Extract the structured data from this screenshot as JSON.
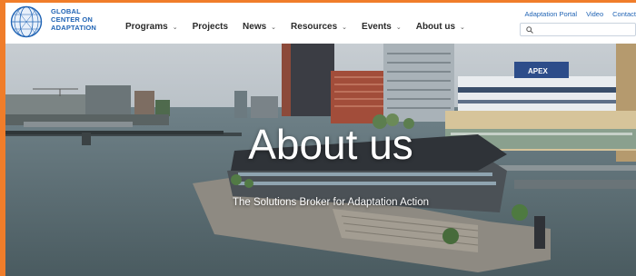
{
  "logo": {
    "lines": [
      "GLOBAL",
      "CENTER ON",
      "ADAPTATION"
    ],
    "icon": "globe-icon"
  },
  "nav": [
    {
      "label": "Programs",
      "has_dropdown": true
    },
    {
      "label": "Projects",
      "has_dropdown": false
    },
    {
      "label": "News",
      "has_dropdown": true
    },
    {
      "label": "Resources",
      "has_dropdown": true
    },
    {
      "label": "Events",
      "has_dropdown": true
    },
    {
      "label": "About us",
      "has_dropdown": true
    }
  ],
  "utility_links": [
    "Adaptation Portal",
    "Video",
    "Contact"
  ],
  "search": {
    "placeholder": "",
    "icon": "search-icon"
  },
  "hero": {
    "title": "About us",
    "subtitle": "The Solutions Broker for Adaptation Action",
    "ship_label": "APEX"
  },
  "colors": {
    "accent_frame": "#f07d2a",
    "brand_blue": "#1f63b4",
    "nav_text": "#2a2a2a"
  }
}
